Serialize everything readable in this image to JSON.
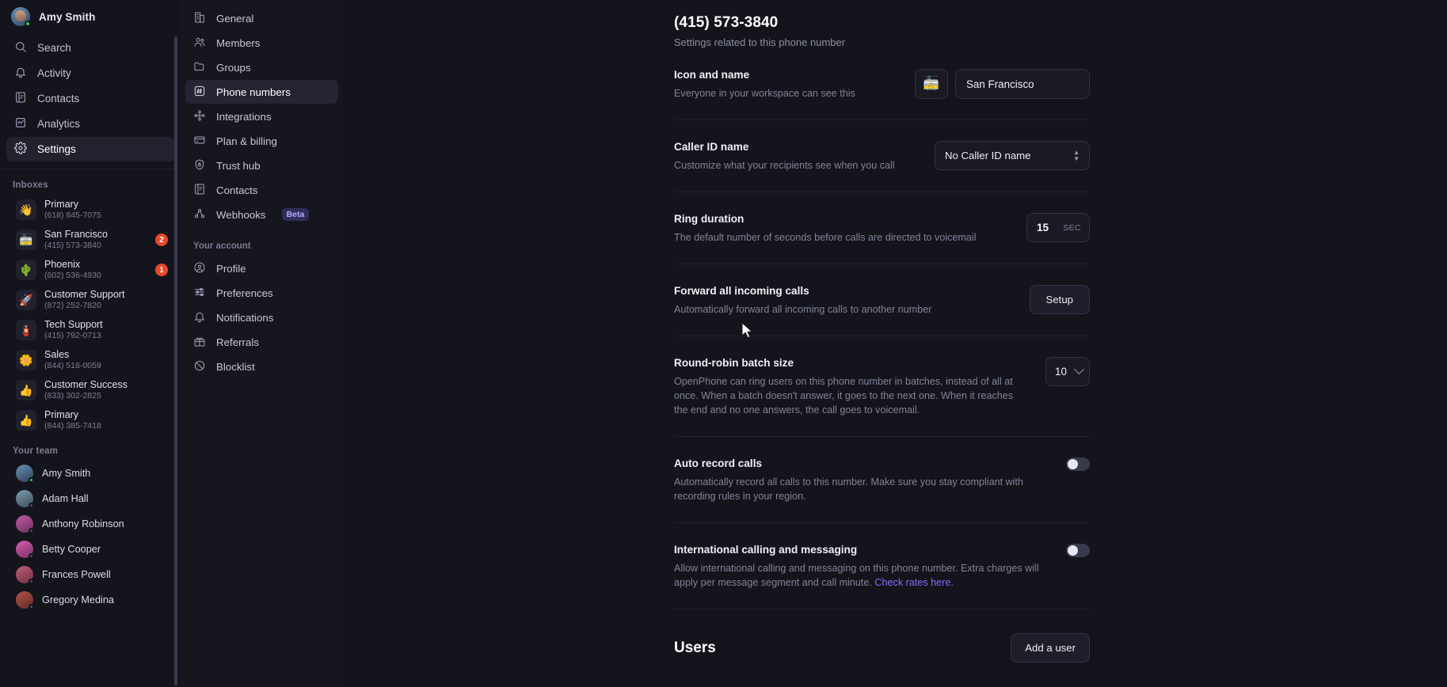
{
  "sidebar": {
    "user": {
      "name": "Amy Smith",
      "status": "online"
    },
    "nav": [
      {
        "label": "Search",
        "icon": "search-icon",
        "active": false
      },
      {
        "label": "Activity",
        "icon": "bell-icon",
        "active": false
      },
      {
        "label": "Contacts",
        "icon": "contacts-book-icon",
        "active": false
      },
      {
        "label": "Analytics",
        "icon": "analytics-chart-icon",
        "active": false
      },
      {
        "label": "Settings",
        "icon": "gear-icon",
        "active": true
      }
    ],
    "inboxes_label": "Inboxes",
    "inboxes": [
      {
        "name": "Primary",
        "number": "(618) 845-7075",
        "emoji": "👋",
        "badge": ""
      },
      {
        "name": "San Francisco",
        "number": "(415) 573-3840",
        "emoji": "🚋",
        "badge": "2"
      },
      {
        "name": "Phoenix",
        "number": "(602) 536-4930",
        "emoji": "🌵",
        "badge": "1"
      },
      {
        "name": "Customer Support",
        "number": "(872) 252-7820",
        "emoji": "🚀",
        "badge": ""
      },
      {
        "name": "Tech Support",
        "number": "(415) 792-0713",
        "emoji": "🧯",
        "badge": ""
      },
      {
        "name": "Sales",
        "number": "(844) 518-0059",
        "emoji": "🌼",
        "badge": ""
      },
      {
        "name": "Customer Success",
        "number": "(833) 302-2825",
        "emoji": "👍",
        "badge": ""
      },
      {
        "name": "Primary",
        "number": "(844) 385-7418",
        "emoji": "👍",
        "badge": ""
      }
    ],
    "team_label": "Your team",
    "team": [
      {
        "name": "Amy Smith",
        "status": "online",
        "color1": "#6b8fb5",
        "color2": "#2d4257"
      },
      {
        "name": "Adam Hall",
        "status": "offline",
        "color1": "#7e9ab0",
        "color2": "#3b4f5e"
      },
      {
        "name": "Anthony Robinson",
        "status": "offline",
        "color1": "#c05ba8",
        "color2": "#6d2f5c"
      },
      {
        "name": "Betty Cooper",
        "status": "offline",
        "color1": "#d45fb0",
        "color2": "#7a2f63"
      },
      {
        "name": "Frances Powell",
        "status": "offline",
        "color1": "#c4607a",
        "color2": "#6d2f40"
      },
      {
        "name": "Gregory Medina",
        "status": "offline",
        "color1": "#b0544a",
        "color2": "#632a24"
      }
    ]
  },
  "settings_nav": {
    "workspace_items": [
      {
        "label": "General",
        "icon": "building-icon",
        "active": false
      },
      {
        "label": "Members",
        "icon": "people-icon",
        "active": false
      },
      {
        "label": "Groups",
        "icon": "folder-icon",
        "active": false
      },
      {
        "label": "Phone numbers",
        "icon": "hash-square-icon",
        "active": true
      },
      {
        "label": "Integrations",
        "icon": "integrations-node-icon",
        "active": false
      },
      {
        "label": "Plan & billing",
        "icon": "credit-card-icon",
        "active": false
      },
      {
        "label": "Trust hub",
        "icon": "shield-lock-icon",
        "active": false
      },
      {
        "label": "Contacts",
        "icon": "contacts-book-icon",
        "active": false
      },
      {
        "label": "Webhooks",
        "icon": "webhook-icon",
        "active": false,
        "badge": "Beta"
      }
    ],
    "account_label": "Your account",
    "account_items": [
      {
        "label": "Profile",
        "icon": "user-circle-icon",
        "active": false
      },
      {
        "label": "Preferences",
        "icon": "sliders-icon",
        "active": false
      },
      {
        "label": "Notifications",
        "icon": "bell-icon",
        "active": false
      },
      {
        "label": "Referrals",
        "icon": "gift-icon",
        "active": false
      },
      {
        "label": "Blocklist",
        "icon": "block-circle-icon",
        "active": false
      }
    ]
  },
  "main": {
    "title": "(415) 573-3840",
    "subtitle": "Settings related to this phone number",
    "rows": {
      "icon_name": {
        "title": "Icon and name",
        "desc": "Everyone in your workspace can see this",
        "emoji": "🚋",
        "value": "San Francisco"
      },
      "caller_id": {
        "title": "Caller ID name",
        "desc": "Customize what your recipients see when you call",
        "selected": "No Caller ID name"
      },
      "ring_duration": {
        "title": "Ring duration",
        "desc": "The default number of seconds before calls are directed to voicemail",
        "value": "15",
        "unit": "SEC"
      },
      "forward_calls": {
        "title": "Forward all incoming calls",
        "desc": "Automatically forward all incoming calls to another number",
        "button": "Setup"
      },
      "round_robin": {
        "title": "Round-robin batch size",
        "desc": "OpenPhone can ring users on this phone number in batches, instead of all at once. When a batch doesn't answer, it goes to the next one. When it reaches the end and no one answers, the call goes to voicemail.",
        "value": "10"
      },
      "auto_record": {
        "title": "Auto record calls",
        "desc": "Automatically record all calls to this number. Make sure you stay compliant with recording rules in your region.",
        "enabled": false
      },
      "international": {
        "title": "International calling and messaging",
        "desc_before": "Allow international calling and messaging on this phone number. Extra charges will apply per message segment and call minute. ",
        "link": "Check rates here.",
        "enabled": false
      }
    },
    "users_section": {
      "title": "Users",
      "add_button": "Add a user"
    }
  },
  "colors": {
    "accent_purple": "#5b4ddb",
    "link_purple": "#8b6bf5",
    "badge_red": "#e8482a",
    "beta_bg": "#312e59"
  }
}
